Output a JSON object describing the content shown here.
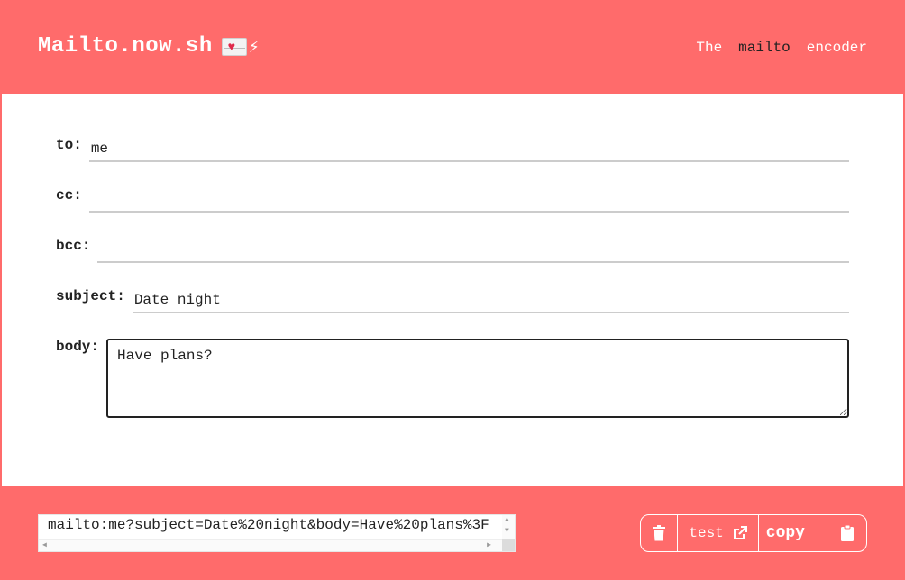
{
  "header": {
    "brand": "Mailto.now.sh",
    "tagline": [
      "The",
      "mailto",
      "encoder"
    ],
    "highlight_index": 1
  },
  "form": {
    "to": {
      "label": "to:",
      "value": "me"
    },
    "cc": {
      "label": "cc:",
      "value": ""
    },
    "bcc": {
      "label": "bcc:",
      "value": ""
    },
    "subject": {
      "label": "subject:",
      "value": "Date night"
    },
    "body": {
      "label": "body:",
      "value": "Have plans?"
    }
  },
  "footer": {
    "url": "mailto:me?subject=Date%20night&body=Have%20plans%3F",
    "test_label": "test",
    "copy_label": "copy"
  },
  "icons": {
    "brand_emoji": [
      "love-letter-icon",
      "lightning-icon"
    ],
    "clear": "trash-icon",
    "test": "external-link-icon",
    "copy": "clipboard-icon"
  },
  "colors": {
    "primary": "#ff6b6b",
    "card": "#ffffff",
    "text": "#222222"
  }
}
